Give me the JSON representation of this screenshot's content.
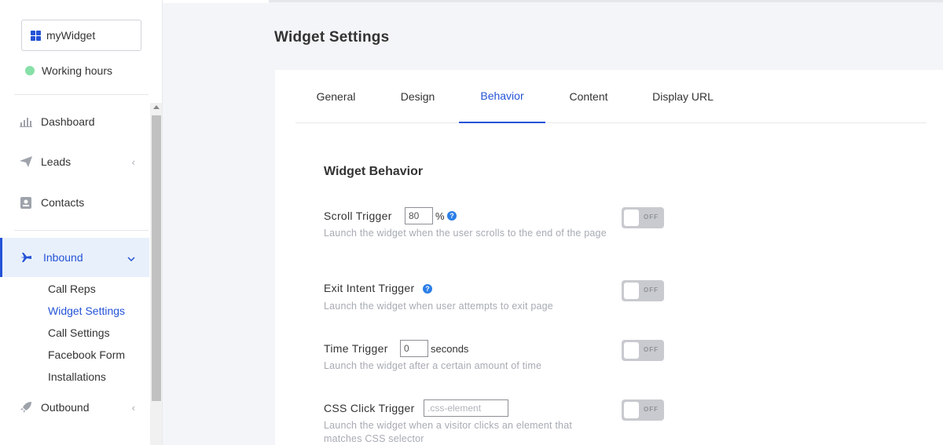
{
  "sidebar": {
    "widget_name": "myWidget",
    "status": "Working hours",
    "nav": {
      "dashboard": "Dashboard",
      "leads": "Leads",
      "contacts": "Contacts",
      "inbound": "Inbound",
      "outbound": "Outbound"
    },
    "inbound_sub": [
      "Call Reps",
      "Widget Settings",
      "Call Settings",
      "Facebook Form",
      "Installations"
    ]
  },
  "page": {
    "title": "Widget Settings",
    "tabs": [
      "General",
      "Design",
      "Behavior",
      "Content",
      "Display URL"
    ],
    "active_tab": "Behavior",
    "section_title": "Widget Behavior"
  },
  "behavior": {
    "scroll": {
      "label": "Scroll Trigger",
      "value": "80",
      "unit": "%",
      "desc": "Launch the widget when the user scrolls to the end of the page",
      "toggle": "OFF"
    },
    "exit": {
      "label": "Exit Intent Trigger",
      "desc": "Launch the widget when user attempts to exit page",
      "toggle": "OFF"
    },
    "time": {
      "label": "Time Trigger",
      "value": "0",
      "unit": "seconds",
      "desc": "Launch the widget after a certain amount of time",
      "toggle": "OFF"
    },
    "css": {
      "label": "CSS Click Trigger",
      "placeholder": ".css-element",
      "desc": "Launch the widget when a visitor clicks an element that matches CSS selector",
      "toggle": "OFF"
    }
  },
  "colors": {
    "accent": "#2453d6",
    "active_bg": "#e8f0fb",
    "status_green": "#86e0a7",
    "help_blue": "#2b7ee6",
    "toggle_off": "#c8cacf"
  },
  "icons": {
    "widget": "grid-icon",
    "dashboard": "bar-chart-icon",
    "leads": "paper-plane-icon",
    "contacts": "contact-card-icon",
    "inbound": "airplane-icon",
    "outbound": "rocket-icon",
    "help": "question-circle-icon"
  }
}
